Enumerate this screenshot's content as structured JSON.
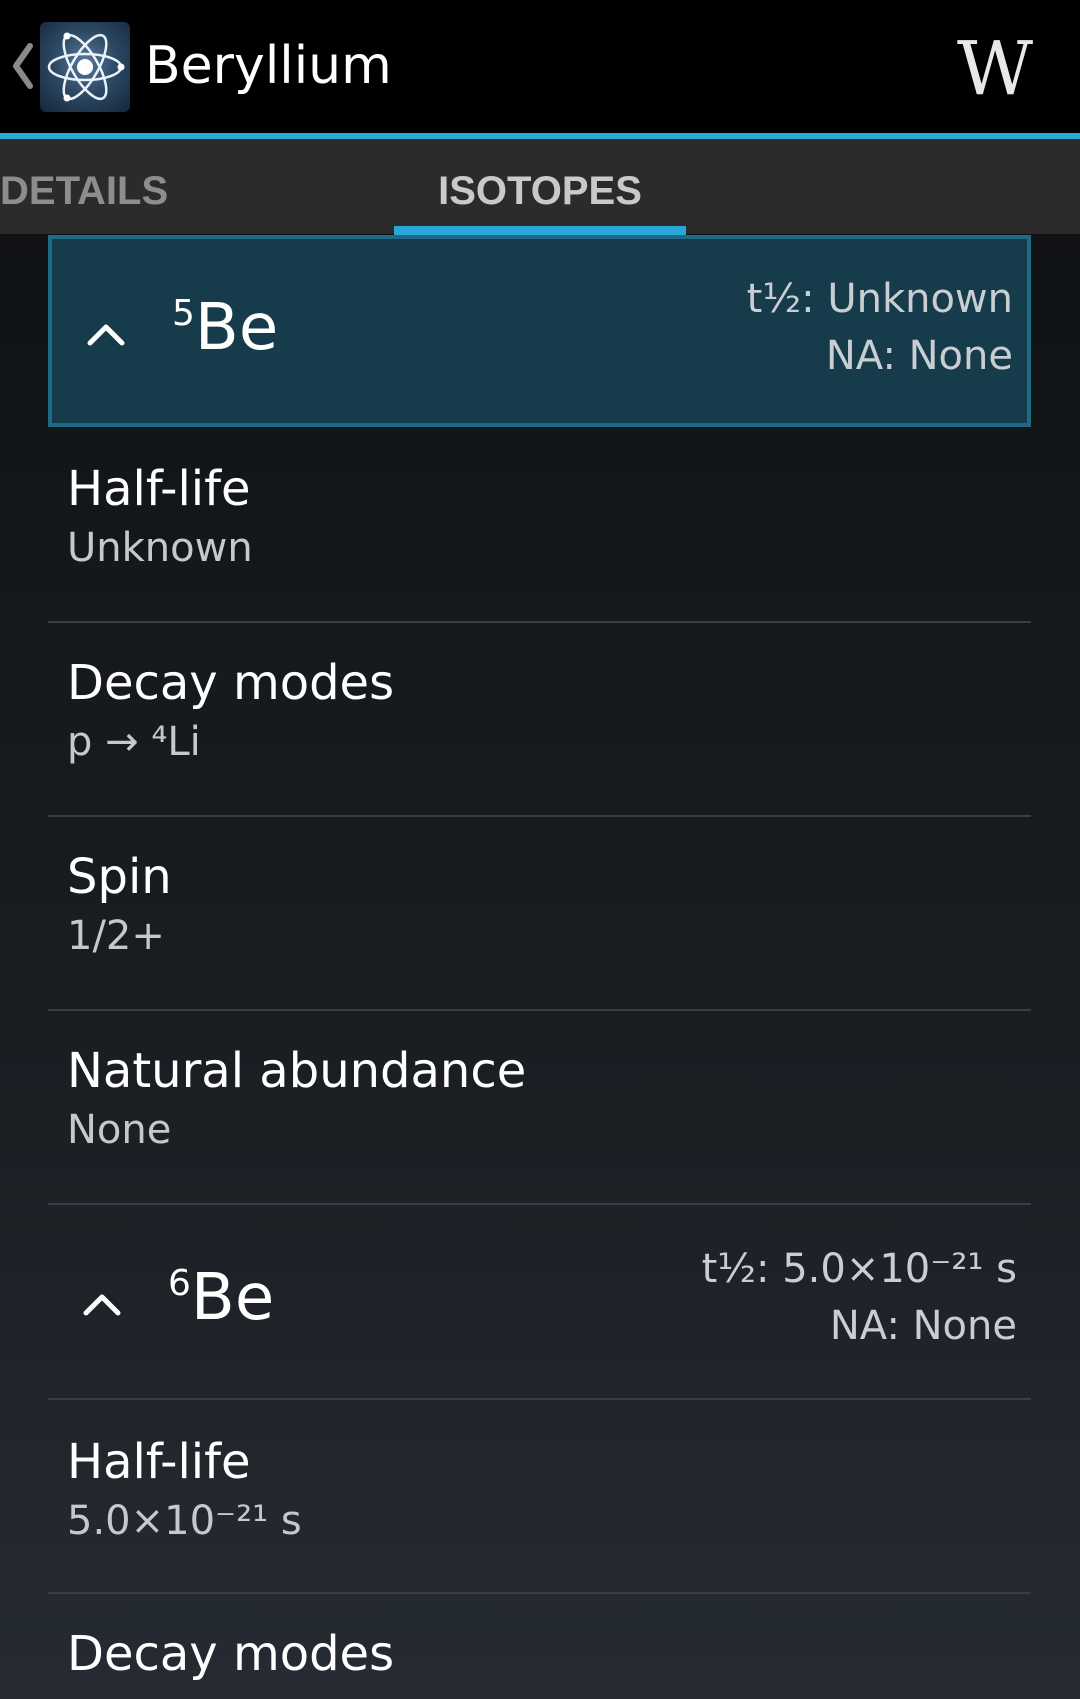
{
  "app": {
    "title": "Beryllium",
    "icon_name": "atom-icon",
    "back_icon": "chevron-left-icon",
    "wikipedia_icon": "wikipedia-icon",
    "wikipedia_label": "W"
  },
  "tabs": [
    {
      "label": "DETAILS",
      "selected": false
    },
    {
      "label": "ISOTOPES",
      "selected": true
    }
  ],
  "colors": {
    "accent": "#2aa7d9",
    "selected_header_bg": "#163c4b",
    "selected_header_border": "#1f6b86"
  },
  "isotopes": [
    {
      "mass": "5",
      "symbol": "Be",
      "expanded": true,
      "selected": true,
      "summary_half_life": "t½: Unknown",
      "summary_na": "NA: None",
      "properties": [
        {
          "label": "Half-life",
          "value": "Unknown"
        },
        {
          "label": "Decay modes",
          "value": "p → ⁴Li"
        },
        {
          "label": "Spin",
          "value": "1/2+"
        },
        {
          "label": "Natural abundance",
          "value": "None"
        }
      ]
    },
    {
      "mass": "6",
      "symbol": "Be",
      "expanded": true,
      "selected": false,
      "summary_half_life": "t½: 5.0×10⁻²¹ s",
      "summary_na": "NA: None",
      "properties": [
        {
          "label": "Half-life",
          "value": "5.0×10⁻²¹ s"
        },
        {
          "label": "Decay modes",
          "value": ""
        }
      ]
    }
  ]
}
